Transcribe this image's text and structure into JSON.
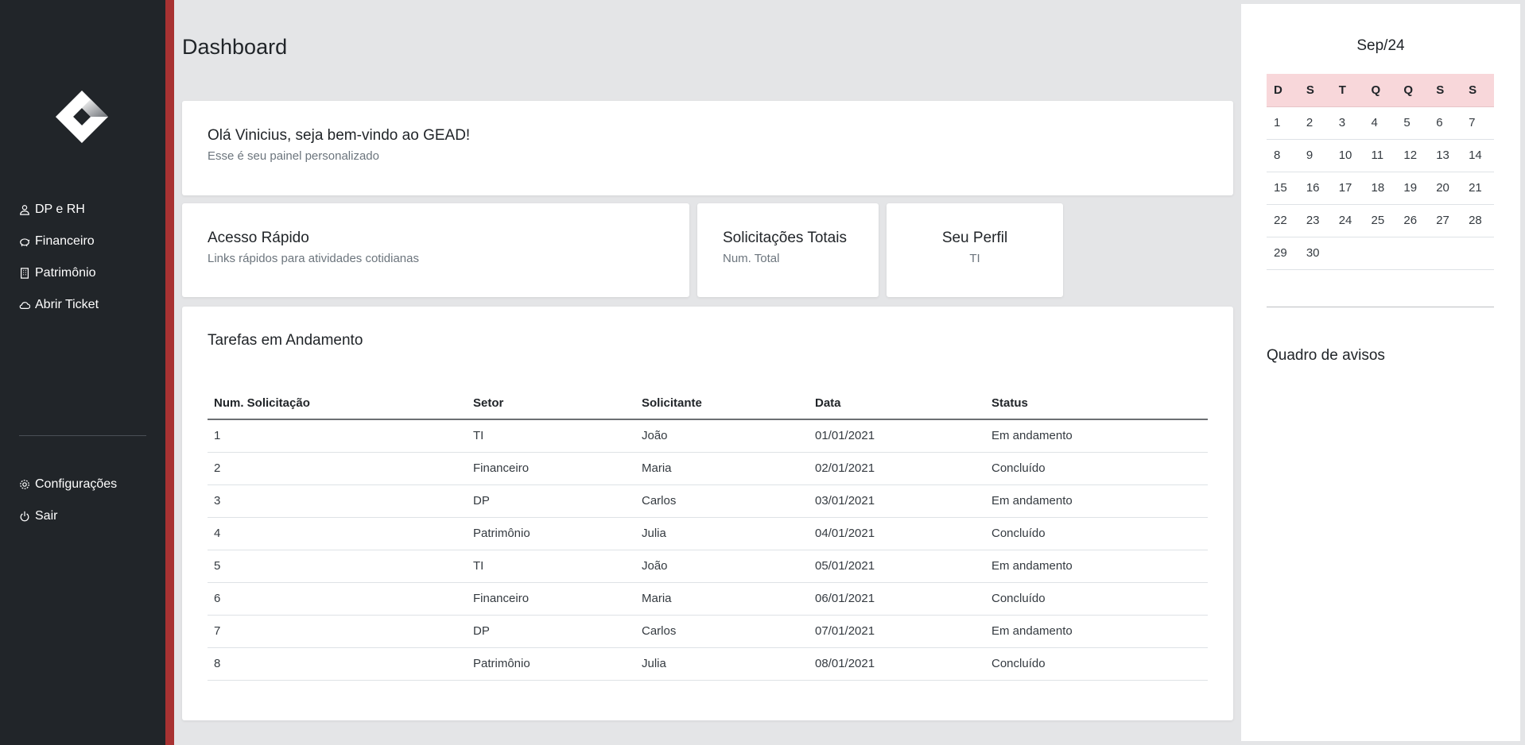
{
  "sidebar": {
    "nav": [
      {
        "label": "DP e RH",
        "icon": "user-icon"
      },
      {
        "label": "Financeiro",
        "icon": "piggy-bank-icon"
      },
      {
        "label": "Patrimônio",
        "icon": "building-icon"
      },
      {
        "label": "Abrir Ticket",
        "icon": "cloud-icon"
      }
    ],
    "bottom": [
      {
        "label": "Configurações",
        "icon": "gear-icon"
      },
      {
        "label": "Sair",
        "icon": "power-icon"
      }
    ],
    "accent_color": "#a83232"
  },
  "page_title": "Dashboard",
  "welcome": {
    "title": "Olá Vinicius, seja bem-vindo ao GEAD!",
    "subtitle": "Esse é seu painel personalizado"
  },
  "quick_access": {
    "title": "Acesso Rápido",
    "subtitle": "Links rápidos para atividades cotidianas"
  },
  "totals": {
    "title": "Solicitações Totais",
    "subtitle": "Num. Total"
  },
  "profile": {
    "title": "Seu Perfil",
    "subtitle": "TI"
  },
  "tasks": {
    "title": "Tarefas em Andamento",
    "columns": [
      "Num. Solicitação",
      "Setor",
      "Solicitante",
      "Data",
      "Status"
    ],
    "rows": [
      [
        "1",
        "TI",
        "João",
        "01/01/2021",
        "Em andamento"
      ],
      [
        "2",
        "Financeiro",
        "Maria",
        "02/01/2021",
        "Concluído"
      ],
      [
        "3",
        "DP",
        "Carlos",
        "03/01/2021",
        "Em andamento"
      ],
      [
        "4",
        "Patrimônio",
        "Julia",
        "04/01/2021",
        "Concluído"
      ],
      [
        "5",
        "TI",
        "João",
        "05/01/2021",
        "Em andamento"
      ],
      [
        "6",
        "Financeiro",
        "Maria",
        "06/01/2021",
        "Concluído"
      ],
      [
        "7",
        "DP",
        "Carlos",
        "07/01/2021",
        "Em andamento"
      ],
      [
        "8",
        "Patrimônio",
        "Julia",
        "08/01/2021",
        "Concluído"
      ]
    ]
  },
  "calendar": {
    "title": "Sep/24",
    "weekdays": [
      "D",
      "S",
      "T",
      "Q",
      "Q",
      "S",
      "S"
    ],
    "weeks": [
      [
        "1",
        "2",
        "3",
        "4",
        "5",
        "6",
        "7"
      ],
      [
        "8",
        "9",
        "10",
        "11",
        "12",
        "13",
        "14"
      ],
      [
        "15",
        "16",
        "17",
        "18",
        "19",
        "20",
        "21"
      ],
      [
        "22",
        "23",
        "24",
        "25",
        "26",
        "27",
        "28"
      ],
      [
        "29",
        "30",
        "",
        "",
        "",
        "",
        ""
      ]
    ],
    "header_color": "#f8d7da"
  },
  "notice_board": {
    "title": "Quadro de avisos"
  }
}
